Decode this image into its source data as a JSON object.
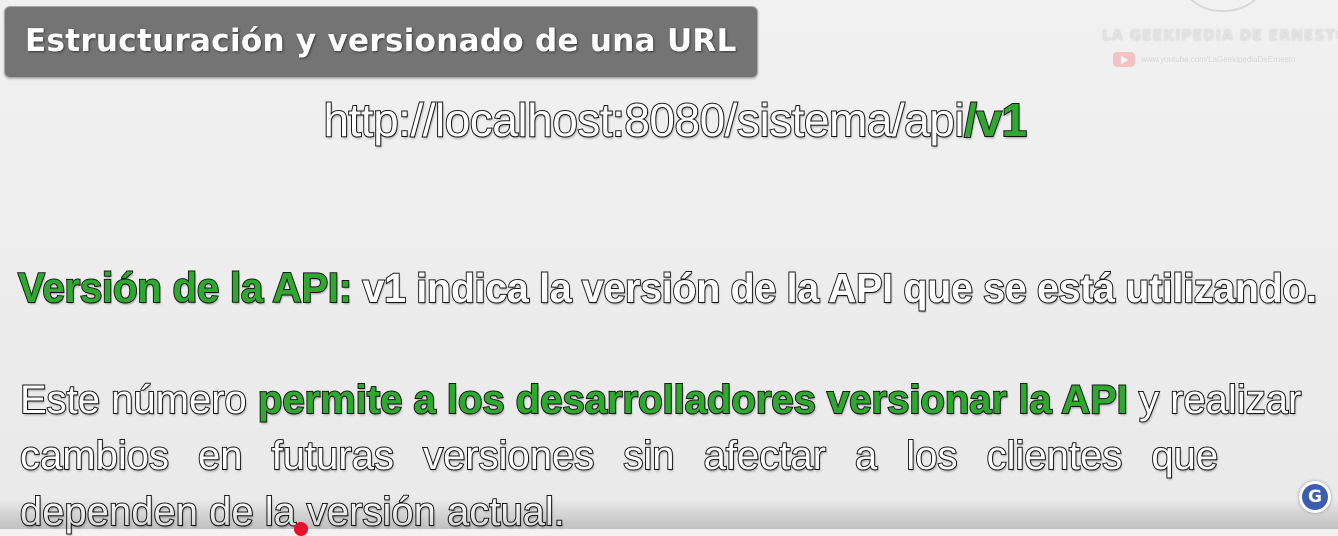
{
  "title": "Estructuración y versionado de una URL",
  "brand": {
    "name": "LA GEEKIPEDIA DE ERNESTO",
    "url": "www.youtube.com/LaGeekipediaDeErnesto",
    "icon": "youtube-icon"
  },
  "url": {
    "base": "http://localhost:8080/sistema/api",
    "version": "/v1"
  },
  "version_line": {
    "label": "Versión de la API:",
    "text": " v1 indica la versión de la API que se está utilizando."
  },
  "paragraph": {
    "l1_start": "Este número ",
    "l1_highlight": "permite a los desarrolladores versionar la API",
    "l1_end": " y realizar",
    "l2": "cambios en futuras versiones sin afectar a los clientes que",
    "l3": "dependen de la versión actual."
  },
  "badge": {
    "letter": "G",
    "icon": "g-logo-icon"
  },
  "colors": {
    "highlight": "#2fa82f",
    "title_bg": "#747474",
    "badge": "#3b5fae",
    "cursor": "#e8112d"
  }
}
